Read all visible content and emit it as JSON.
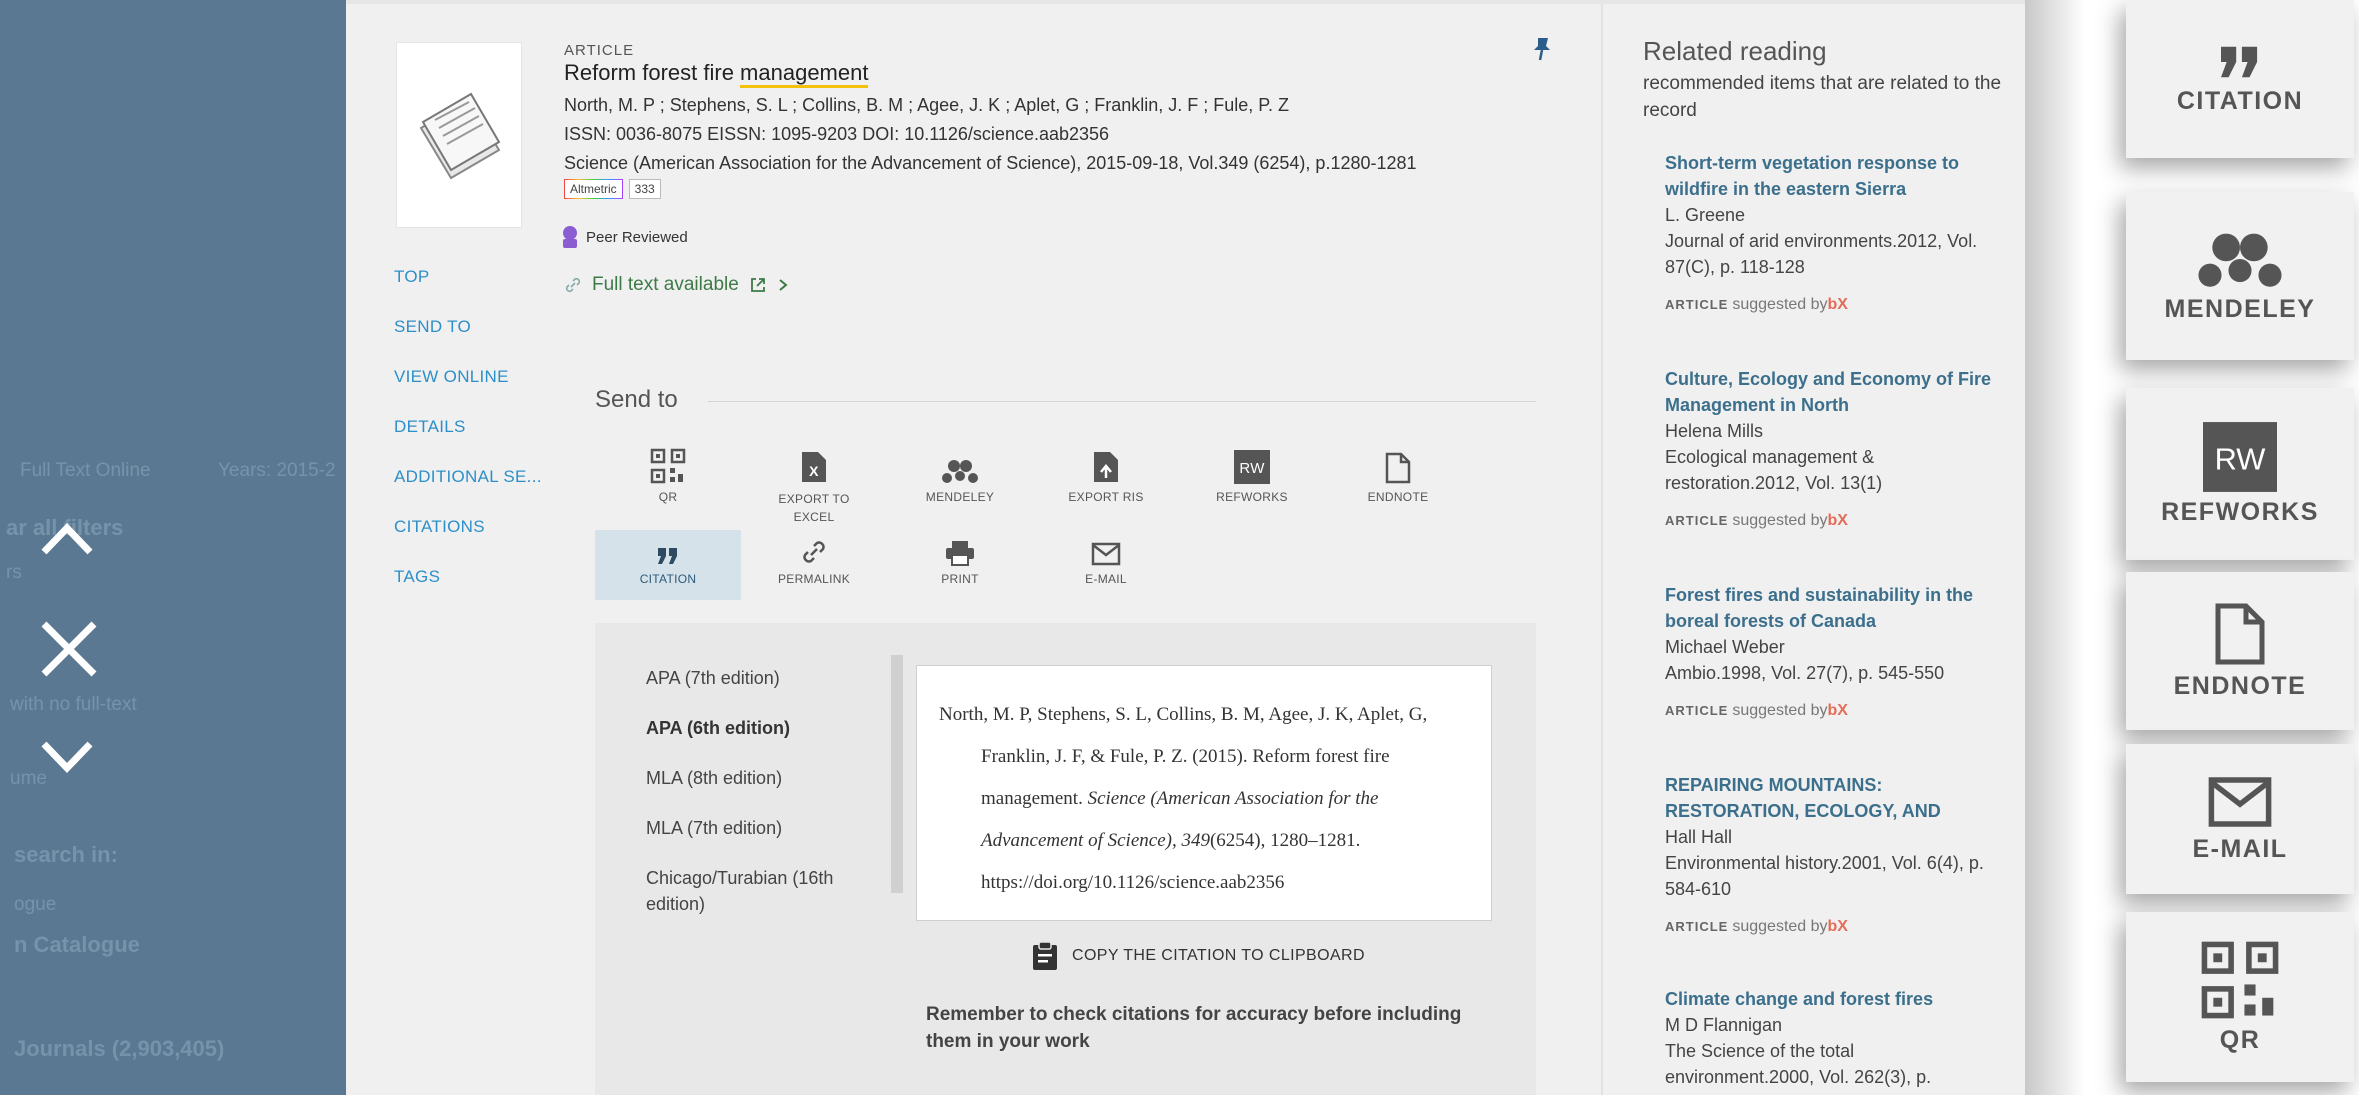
{
  "overlay": {
    "ghost_texts": [
      "Full Text Online",
      "Years: 2015-2",
      "ar all filters",
      "rs",
      "with no full-text",
      "ume",
      "search in:",
      "ogue",
      "n Catalogue",
      "Journals (2,903,405)"
    ]
  },
  "record": {
    "type": "ARTICLE",
    "title_prefix": "Reform forest fire ",
    "title_highlight": "management",
    "authors": "North, M. P ; Stephens, S. L ; Collins, B. M ; Agee, J. K ; Aplet, G ; Franklin, J. F ; Fule, P. Z",
    "identifiers": "ISSN: 0036-8075 EISSN: 1095-9203 DOI: 10.1126/science.aab2356",
    "source": "Science (American Association for the Advancement of Science), 2015-09-18, Vol.349 (6254), p.1280-1281",
    "altmetric_label": "Altmetric",
    "altmetric_score": "333",
    "peer_reviewed": "Peer Reviewed",
    "fulltext": "Full text available"
  },
  "leftnav": [
    "TOP",
    "SEND TO",
    "VIEW ONLINE",
    "DETAILS",
    "ADDITIONAL SE...",
    "CITATIONS",
    "TAGS"
  ],
  "sendto": {
    "title": "Send to",
    "actions_row1": [
      {
        "label": "QR",
        "icon": "qr-icon"
      },
      {
        "label": "EXPORT TO EXCEL",
        "icon": "excel-icon"
      },
      {
        "label": "MENDELEY",
        "icon": "mendeley-icon"
      },
      {
        "label": "EXPORT RIS",
        "icon": "ris-icon"
      },
      {
        "label": "REFWORKS",
        "icon": "refworks-icon"
      },
      {
        "label": "ENDNOTE",
        "icon": "endnote-icon"
      }
    ],
    "actions_row2": [
      {
        "label": "CITATION",
        "icon": "quote-icon"
      },
      {
        "label": "PERMALINK",
        "icon": "link-icon"
      },
      {
        "label": "PRINT",
        "icon": "print-icon"
      },
      {
        "label": "E-MAIL",
        "icon": "mail-icon"
      }
    ]
  },
  "citation": {
    "styles": [
      "APA (7th edition)",
      "APA (6th edition)",
      "MLA (8th edition)",
      "MLA (7th edition)",
      "Chicago/Turabian (16th edition)"
    ],
    "selected_style": "APA (6th edition)",
    "text_plain1": "North, M. P, Stephens, S. L, Collins, B. M, Agee, J. K, Aplet, G, Franklin, J. F, & Fule, P. Z. (2015). Reform forest fire management. ",
    "text_italic1": "Science (American Association for the Advancement of Science), 349",
    "text_plain2": "(6254), 1280–1281. https://doi.org/10.1126/science.aab2356",
    "copy_label": "COPY THE CITATION TO CLIPBOARD",
    "reminder": "Remember to check citations for accuracy before including them in your work"
  },
  "related": {
    "title": "Related reading",
    "subtitle": "recommended items that are related to the record",
    "suggested_type": "ARTICLE",
    "suggested_text": "suggested by",
    "suggested_brand": "bX",
    "items": [
      {
        "title": "Short-term vegetation response to wildfire in the eastern Sierra",
        "author": "L. Greene",
        "source": "Journal of arid environments.2012, Vol. 87(C), p. 118-128"
      },
      {
        "title": "Culture, Ecology and Economy of Fire Management in North",
        "author": "Helena Mills",
        "source": "Ecological management & restoration.2012, Vol. 13(1)"
      },
      {
        "title": "Forest fires and sustainability in the boreal forests of Canada",
        "author": "Michael Weber",
        "source": "Ambio.1998, Vol. 27(7), p. 545-550"
      },
      {
        "title": "REPAIRING MOUNTAINS: RESTORATION, ECOLOGY, AND",
        "author": "Hall Hall",
        "source": "Environmental history.2001, Vol. 6(4), p. 584-610"
      },
      {
        "title": "Climate change and forest fires",
        "author": "M D Flannigan",
        "source": "The Science of the total environment.2000, Vol. 262(3), p."
      }
    ]
  },
  "tiles": [
    {
      "label": "CITATION",
      "icon": "quote-icon"
    },
    {
      "label": "MENDELEY",
      "icon": "mendeley-icon"
    },
    {
      "label": "REFWORKS",
      "icon": "refworks-icon"
    },
    {
      "label": "ENDNOTE",
      "icon": "endnote-icon"
    },
    {
      "label": "E-MAIL",
      "icon": "mail-icon"
    },
    {
      "label": "QR",
      "icon": "qr-icon"
    }
  ]
}
